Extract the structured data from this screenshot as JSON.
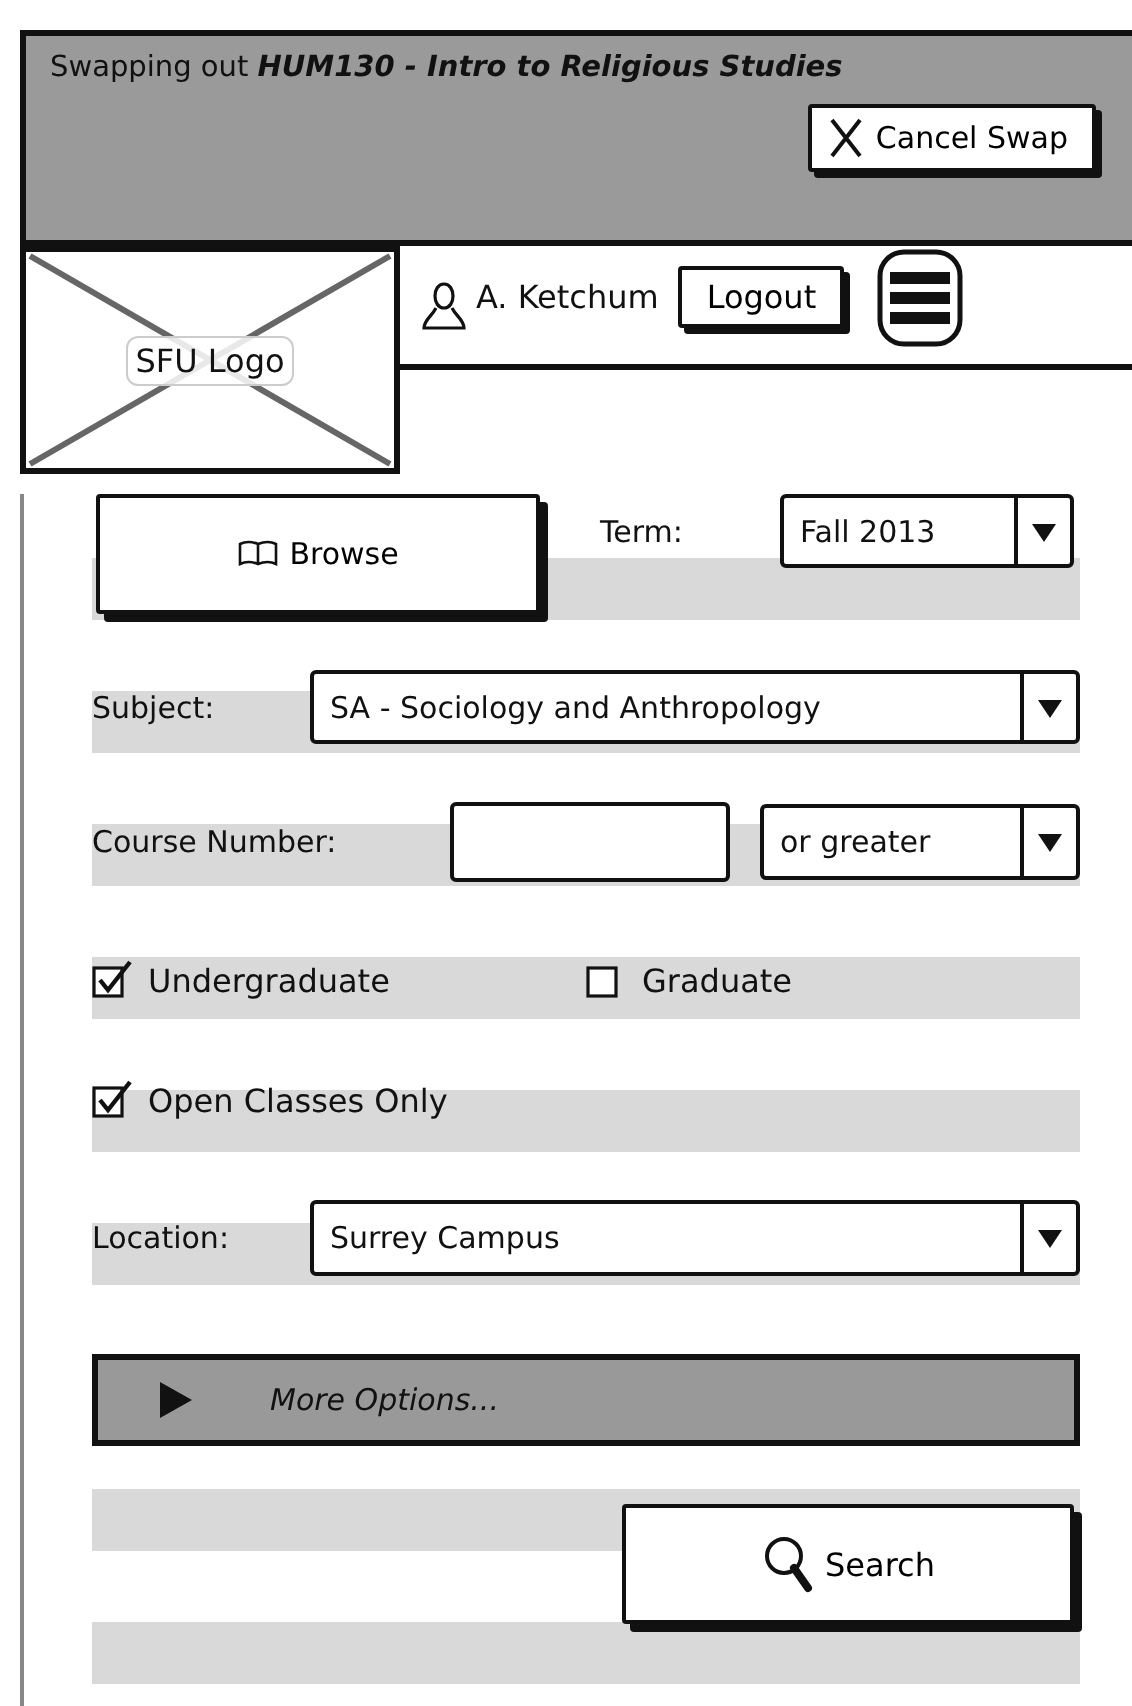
{
  "banner": {
    "message": "Swapping out **HUM130 - Intro to Religious Studies**",
    "cancel_button": "Cancel Swap"
  },
  "header": {
    "logo": "SFU Logo",
    "user": "A. Ketchum",
    "logout_button": "Logout"
  },
  "form": {
    "browse_button": "Browse",
    "term": {
      "label": "Term:",
      "value": "Fall 2013"
    },
    "subject": {
      "label": "Subject:",
      "value": "SA - Sociology and Anthropology"
    },
    "course_number": {
      "label": "Course Number:",
      "modifier": "or greater"
    },
    "checkbox_rows": [
      [
        {
          "label": "Undergraduate",
          "checked": true
        },
        {
          "label": "Graduate",
          "checked": false
        }
      ],
      [
        {
          "label": "Open Classes Only",
          "checked": true
        }
      ]
    ],
    "location": {
      "label": "Location:",
      "value": "Surrey Campus"
    },
    "more_options": {
      "label": "More Options...",
      "expanded": false
    },
    "search_button": "Search"
  }
}
